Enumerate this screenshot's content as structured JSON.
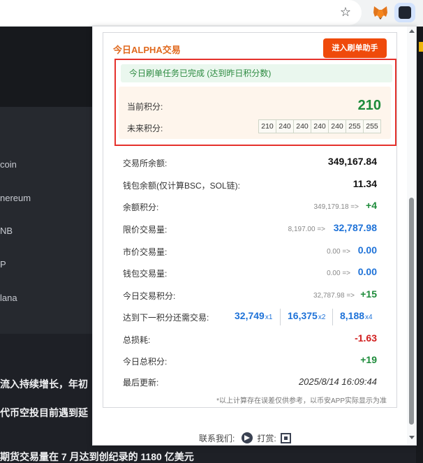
{
  "background": {
    "coins": [
      "coin",
      "nereum",
      "NB",
      "P",
      "lana"
    ],
    "news": [
      "流入持续增长，年初",
      "代币空投目前遇到延",
      "期货交易量在 7 月达到创纪录的 1180 亿美元"
    ]
  },
  "popup": {
    "title": "今日ALPHA交易",
    "cta_label": "进入刷单助手",
    "notice": "今日刷单任务已完成 (达到昨日积分数)",
    "current_points_label": "当前积分:",
    "current_points_value": "210",
    "future_points_label": "未来积分:",
    "future_points": [
      "210",
      "240",
      "240",
      "240",
      "240",
      "255",
      "255"
    ],
    "rows": {
      "exchange_balance": {
        "label": "交易所余额:",
        "value": "349,167.84"
      },
      "wallet_balance": {
        "label": "钱包余额(仅计算BSC，SOL链):",
        "value": "11.34"
      },
      "balance_points": {
        "label": "余额积分:",
        "prefix": "349,179.18 =>",
        "value": "+4"
      },
      "limit_volume": {
        "label": "限价交易量:",
        "prefix": "8,197.00 =>",
        "value": "32,787.98"
      },
      "market_volume": {
        "label": "市价交易量:",
        "prefix": "0.00 =>",
        "value": "0.00"
      },
      "wallet_volume": {
        "label": "钱包交易量:",
        "prefix": "0.00 =>",
        "value": "0.00"
      },
      "today_trade_points": {
        "label": "今日交易积分:",
        "prefix": "32,787.98 =>",
        "value": "+15"
      },
      "next_level": {
        "label": "达到下一积分还需交易:",
        "items": [
          {
            "amount": "32,749",
            "mult": "x1"
          },
          {
            "amount": "16,375",
            "mult": "x2"
          },
          {
            "amount": "8,188",
            "mult": "x4"
          }
        ]
      },
      "total_loss": {
        "label": "总损耗:",
        "value": "-1.63"
      },
      "today_total_points": {
        "label": "今日总积分:",
        "value": "+19"
      },
      "last_update": {
        "label": "最后更新:",
        "value": "2025/8/14 16:09:44"
      }
    },
    "disclaimer": "*以上计算存在误差仅供参考，以币安APP实际显示为准",
    "footer": {
      "contact_label": "联系我们:",
      "tip_label": "打赏:"
    }
  }
}
